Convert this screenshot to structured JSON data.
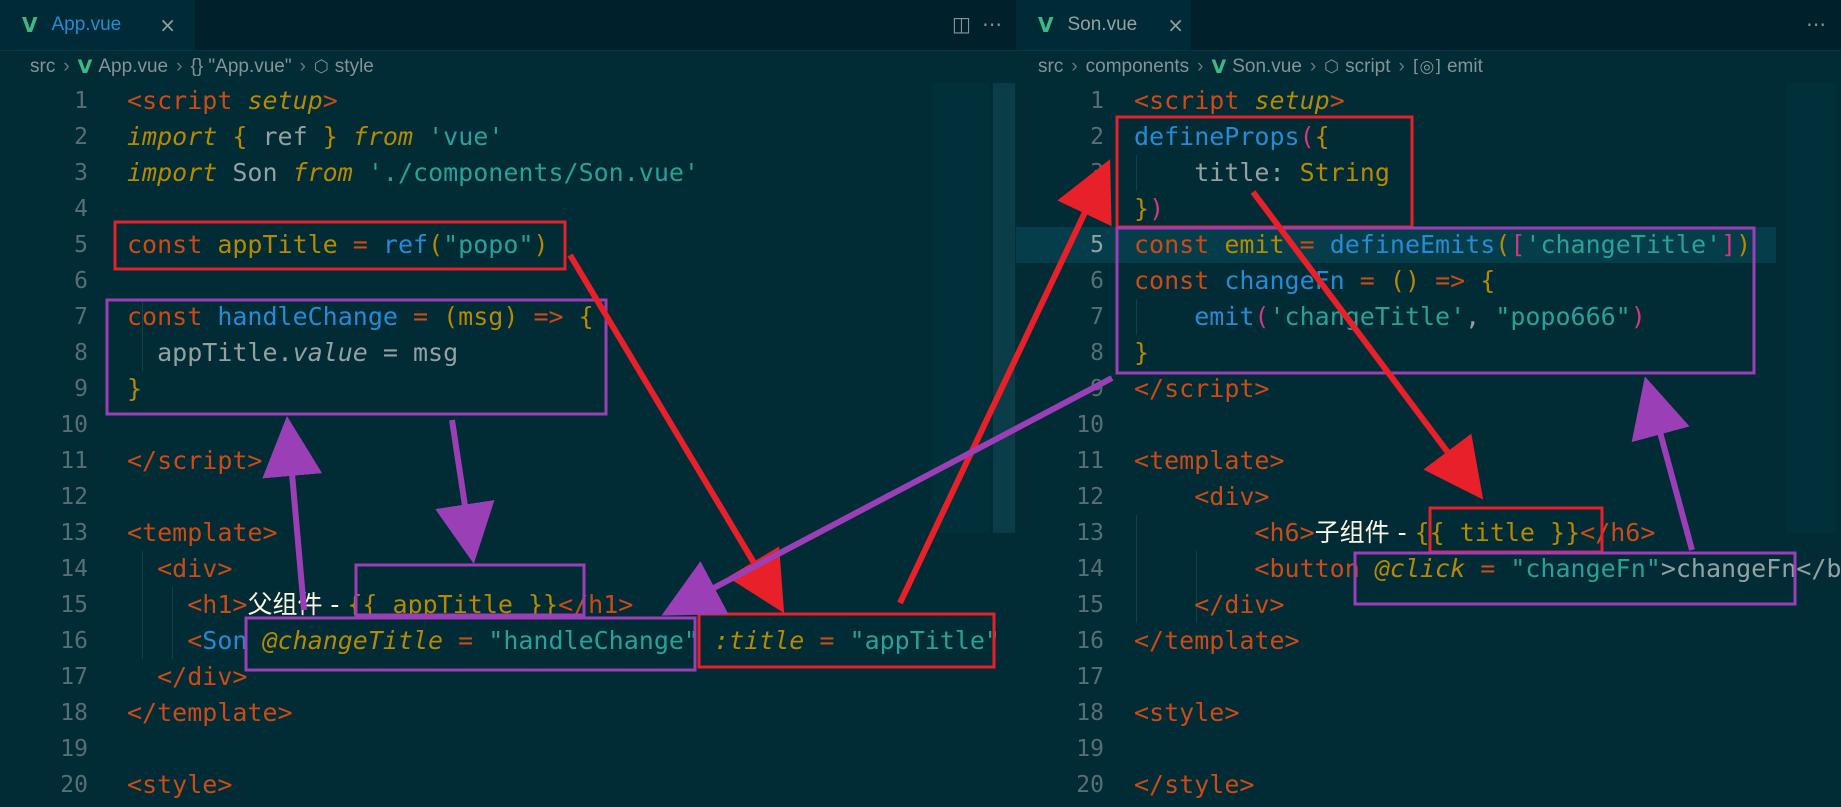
{
  "left": {
    "tab": {
      "icon": "vue-icon",
      "label": "App.vue",
      "close": "×"
    },
    "actions": {
      "split": "◫",
      "more": "⋯"
    },
    "breadcrumb": [
      "src",
      "App.vue",
      "{} \"App.vue\"",
      "style"
    ],
    "line_numbers": [
      "1",
      "2",
      "3",
      "4",
      "5",
      "6",
      "7",
      "8",
      "9",
      "10",
      "11",
      "12",
      "13",
      "14",
      "15",
      "16",
      "17",
      "18",
      "19",
      "20"
    ]
  },
  "right": {
    "tab": {
      "icon": "vue-icon",
      "label": "Son.vue",
      "close": "×"
    },
    "actions": {
      "more": "⋯"
    },
    "breadcrumb": [
      "src",
      "components",
      "Son.vue",
      "script",
      "emit"
    ],
    "line_numbers": [
      "1",
      "2",
      "3",
      "4",
      "5",
      "6",
      "7",
      "8",
      "9",
      "10",
      "11",
      "12",
      "13",
      "14",
      "15",
      "16",
      "17",
      "18",
      "19",
      "20"
    ]
  },
  "annotation_colors": {
    "red": "#e8202a",
    "purple": "#9a3fb5"
  }
}
